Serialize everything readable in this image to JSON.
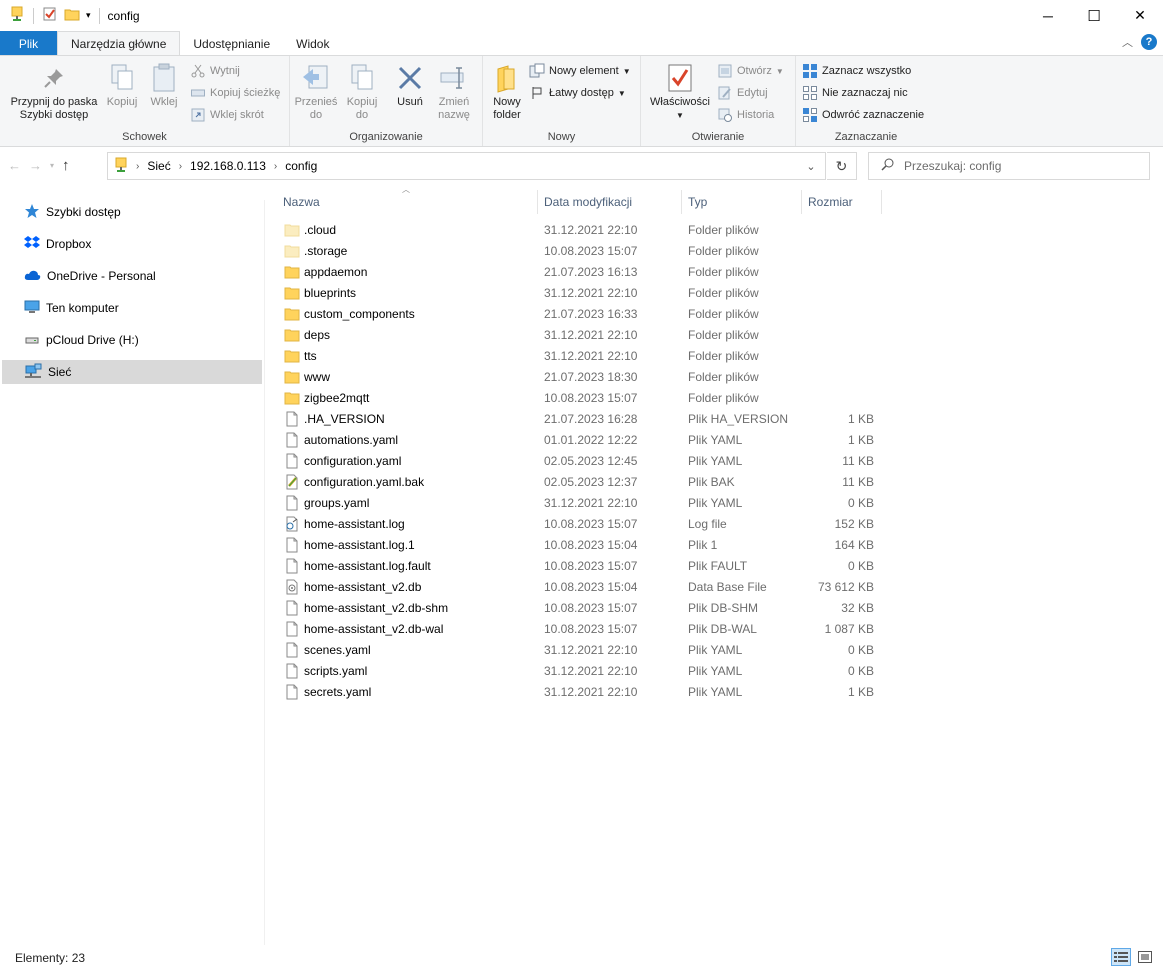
{
  "window": {
    "title": "config",
    "minimize": "─",
    "maximize": "☐",
    "close": "✕"
  },
  "tabs": [
    {
      "label": "Plik"
    },
    {
      "label": "Narzędzia główne"
    },
    {
      "label": "Udostępnianie"
    },
    {
      "label": "Widok"
    }
  ],
  "ribbon": {
    "clipboard": {
      "label": "Schowek",
      "pin_l1": "Przypnij do paska",
      "pin_l2": "Szybki dostęp",
      "copy": "Kopiuj",
      "paste": "Wklej",
      "cut": "Wytnij",
      "copy_path": "Kopiuj ścieżkę",
      "paste_shortcut": "Wklej skrót"
    },
    "organize": {
      "label": "Organizowanie",
      "move_l1": "Przenieś",
      "move_l2": "do",
      "copy_l1": "Kopiuj",
      "copy_l2": "do",
      "delete": "Usuń",
      "rename_l1": "Zmień",
      "rename_l2": "nazwę"
    },
    "new": {
      "label": "Nowy",
      "new_folder_l1": "Nowy",
      "new_folder_l2": "folder",
      "new_item": "Nowy element",
      "easy_access": "Łatwy dostęp"
    },
    "open": {
      "label": "Otwieranie",
      "properties": "Właściwości",
      "open": "Otwórz",
      "edit": "Edytuj",
      "history": "Historia"
    },
    "select": {
      "label": "Zaznaczanie",
      "select_all": "Zaznacz wszystko",
      "select_none": "Nie zaznaczaj nic",
      "invert": "Odwróć zaznaczenie"
    }
  },
  "address": {
    "crumbs": [
      "Sieć",
      "192.168.0.113",
      "config"
    ]
  },
  "search": {
    "placeholder": "Przeszukaj: config"
  },
  "sidebar": {
    "items": [
      {
        "label": "Szybki dostęp"
      },
      {
        "label": "Dropbox"
      },
      {
        "label": "OneDrive - Personal"
      },
      {
        "label": "Ten komputer"
      },
      {
        "label": "pCloud Drive (H:)"
      },
      {
        "label": "Sieć"
      }
    ]
  },
  "columns": {
    "name": "Nazwa",
    "date": "Data modyfikacji",
    "type": "Typ",
    "size": "Rozmiar"
  },
  "files": [
    {
      "name": ".cloud",
      "date": "31.12.2021 22:10",
      "type": "Folder plików",
      "size": "",
      "icon": "folder-light"
    },
    {
      "name": ".storage",
      "date": "10.08.2023 15:07",
      "type": "Folder plików",
      "size": "",
      "icon": "folder-light"
    },
    {
      "name": "appdaemon",
      "date": "21.07.2023 16:13",
      "type": "Folder plików",
      "size": "",
      "icon": "folder"
    },
    {
      "name": "blueprints",
      "date": "31.12.2021 22:10",
      "type": "Folder plików",
      "size": "",
      "icon": "folder"
    },
    {
      "name": "custom_components",
      "date": "21.07.2023 16:33",
      "type": "Folder plików",
      "size": "",
      "icon": "folder"
    },
    {
      "name": "deps",
      "date": "31.12.2021 22:10",
      "type": "Folder plików",
      "size": "",
      "icon": "folder"
    },
    {
      "name": "tts",
      "date": "31.12.2021 22:10",
      "type": "Folder plików",
      "size": "",
      "icon": "folder"
    },
    {
      "name": "www",
      "date": "21.07.2023 18:30",
      "type": "Folder plików",
      "size": "",
      "icon": "folder"
    },
    {
      "name": "zigbee2mqtt",
      "date": "10.08.2023 15:07",
      "type": "Folder plików",
      "size": "",
      "icon": "folder"
    },
    {
      "name": ".HA_VERSION",
      "date": "21.07.2023 16:28",
      "type": "Plik HA_VERSION",
      "size": "1 KB",
      "icon": "file"
    },
    {
      "name": "automations.yaml",
      "date": "01.01.2022 12:22",
      "type": "Plik YAML",
      "size": "1 KB",
      "icon": "file"
    },
    {
      "name": "configuration.yaml",
      "date": "02.05.2023 12:45",
      "type": "Plik YAML",
      "size": "11 KB",
      "icon": "file"
    },
    {
      "name": "configuration.yaml.bak",
      "date": "02.05.2023 12:37",
      "type": "Plik BAK",
      "size": "11 KB",
      "icon": "file-edit"
    },
    {
      "name": "groups.yaml",
      "date": "31.12.2021 22:10",
      "type": "Plik YAML",
      "size": "0 KB",
      "icon": "file"
    },
    {
      "name": "home-assistant.log",
      "date": "10.08.2023 15:07",
      "type": "Log file",
      "size": "152 KB",
      "icon": "file-log"
    },
    {
      "name": "home-assistant.log.1",
      "date": "10.08.2023 15:04",
      "type": "Plik 1",
      "size": "164 KB",
      "icon": "file"
    },
    {
      "name": "home-assistant.log.fault",
      "date": "10.08.2023 15:07",
      "type": "Plik FAULT",
      "size": "0 KB",
      "icon": "file"
    },
    {
      "name": "home-assistant_v2.db",
      "date": "10.08.2023 15:04",
      "type": "Data Base File",
      "size": "73 612 KB",
      "icon": "file-db"
    },
    {
      "name": "home-assistant_v2.db-shm",
      "date": "10.08.2023 15:07",
      "type": "Plik DB-SHM",
      "size": "32 KB",
      "icon": "file"
    },
    {
      "name": "home-assistant_v2.db-wal",
      "date": "10.08.2023 15:07",
      "type": "Plik DB-WAL",
      "size": "1 087 KB",
      "icon": "file"
    },
    {
      "name": "scenes.yaml",
      "date": "31.12.2021 22:10",
      "type": "Plik YAML",
      "size": "0 KB",
      "icon": "file"
    },
    {
      "name": "scripts.yaml",
      "date": "31.12.2021 22:10",
      "type": "Plik YAML",
      "size": "0 KB",
      "icon": "file"
    },
    {
      "name": "secrets.yaml",
      "date": "31.12.2021 22:10",
      "type": "Plik YAML",
      "size": "1 KB",
      "icon": "file"
    }
  ],
  "status": {
    "items": "Elementy: 23"
  },
  "colors": {
    "accent": "#1979ca",
    "folder": "#ffd35c",
    "selected": "#d9d9d9"
  }
}
